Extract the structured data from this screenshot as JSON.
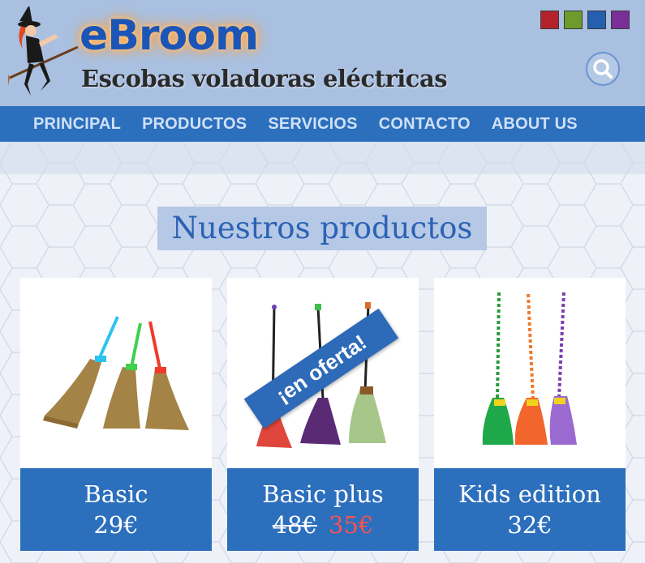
{
  "header": {
    "logo": "eBroom",
    "tagline": "Escobas voladoras eléctricas",
    "theme_swatches": [
      "#b3222c",
      "#6f9a2c",
      "#2560b0",
      "#7a2e96"
    ],
    "search_icon": "search-icon"
  },
  "nav": {
    "items": [
      "PRINCIPAL",
      "PRODUCTOS",
      "SERVICIOS",
      "CONTACTO",
      "ABOUT US"
    ]
  },
  "main": {
    "section_title": "Nuestros productos",
    "products": [
      {
        "name": "Basic",
        "price": "29€"
      },
      {
        "name": "Basic plus",
        "old_price": "48€",
        "price": "35€",
        "badge": "¡en oferta!"
      },
      {
        "name": "Kids edition",
        "price": "32€"
      }
    ]
  },
  "colors": {
    "header_bg": "#a9c0e1",
    "nav_bg": "#2c6fbd",
    "accent": "#2c6fbd",
    "sale_price": "#ff5151"
  }
}
